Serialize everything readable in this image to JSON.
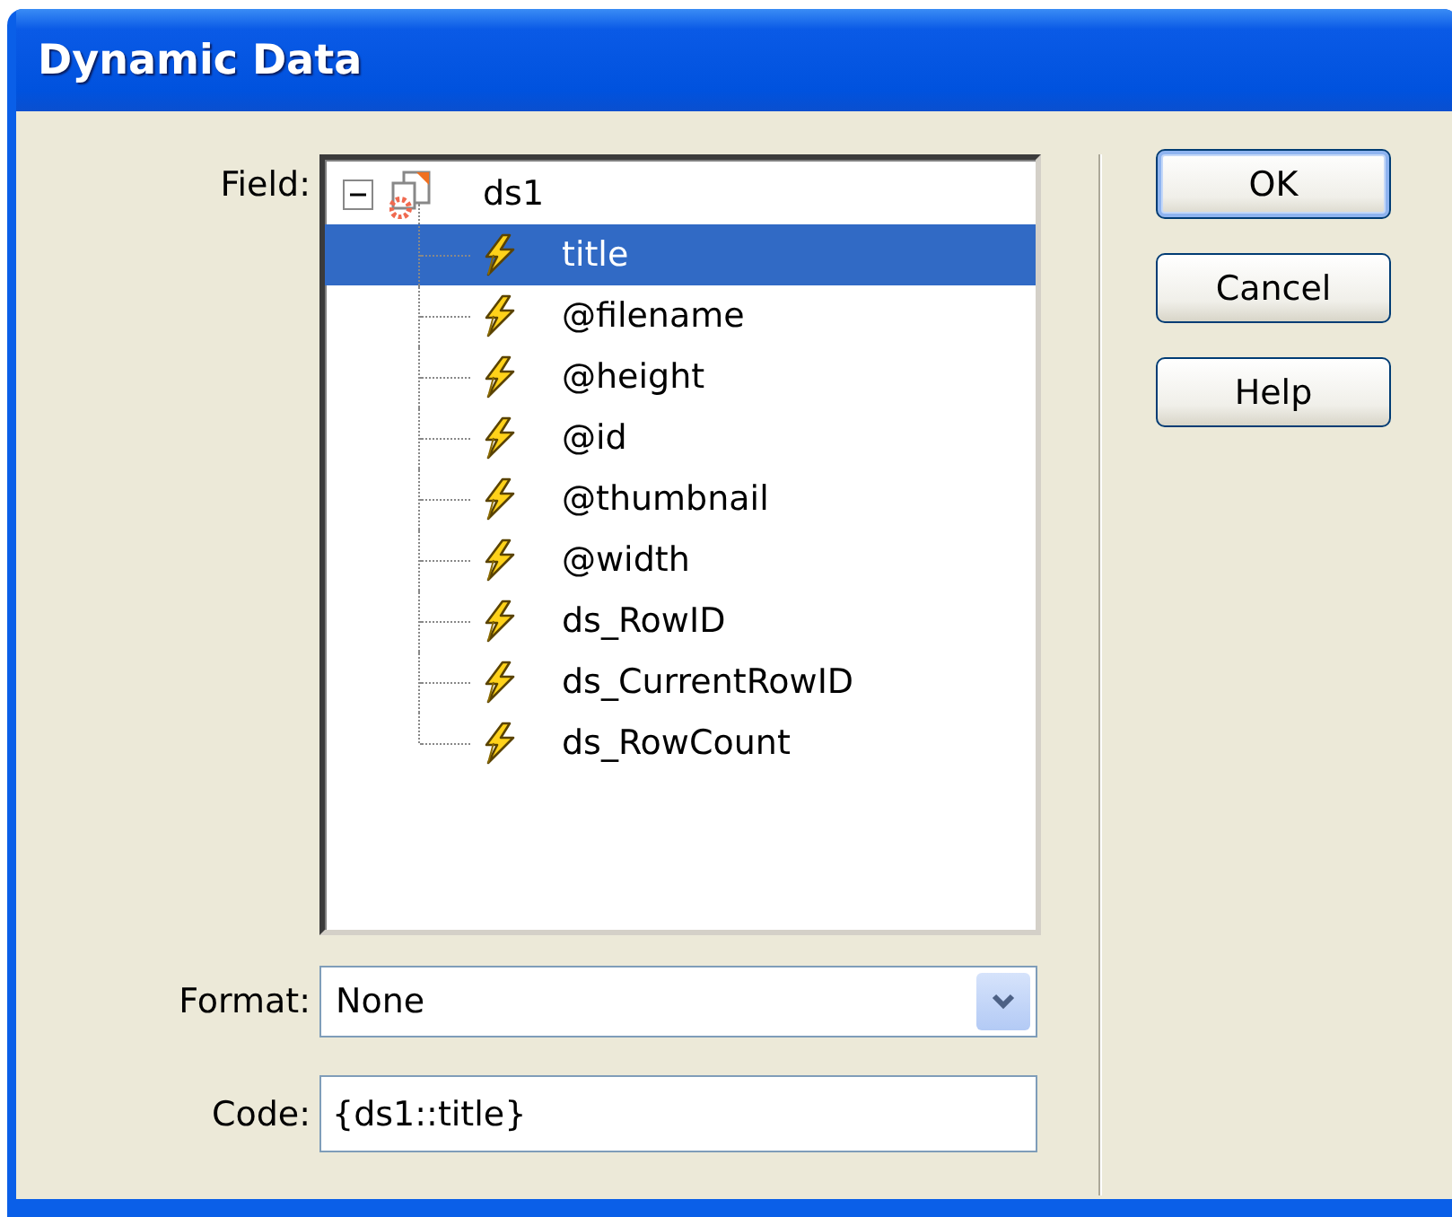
{
  "window": {
    "title": "Dynamic Data"
  },
  "field": {
    "label": "Field:",
    "tree": [
      {
        "label": "ds1",
        "kind": "dataset",
        "expanded": true,
        "selected": false,
        "children": [
          {
            "label": "title",
            "kind": "field",
            "selected": true
          },
          {
            "label": "@filename",
            "kind": "field",
            "selected": false
          },
          {
            "label": "@height",
            "kind": "field",
            "selected": false
          },
          {
            "label": "@id",
            "kind": "field",
            "selected": false
          },
          {
            "label": "@thumbnail",
            "kind": "field",
            "selected": false
          },
          {
            "label": "@width",
            "kind": "field",
            "selected": false
          },
          {
            "label": "ds_RowID",
            "kind": "field",
            "selected": false
          },
          {
            "label": "ds_CurrentRowID",
            "kind": "field",
            "selected": false
          },
          {
            "label": "ds_RowCount",
            "kind": "field",
            "selected": false
          }
        ]
      }
    ]
  },
  "format": {
    "label": "Format:",
    "value": "None"
  },
  "code": {
    "label": "Code:",
    "value": "{ds1::title}"
  },
  "buttons": [
    {
      "label": "OK",
      "default": true
    },
    {
      "label": "Cancel",
      "default": false
    },
    {
      "label": "Help",
      "default": false
    }
  ]
}
